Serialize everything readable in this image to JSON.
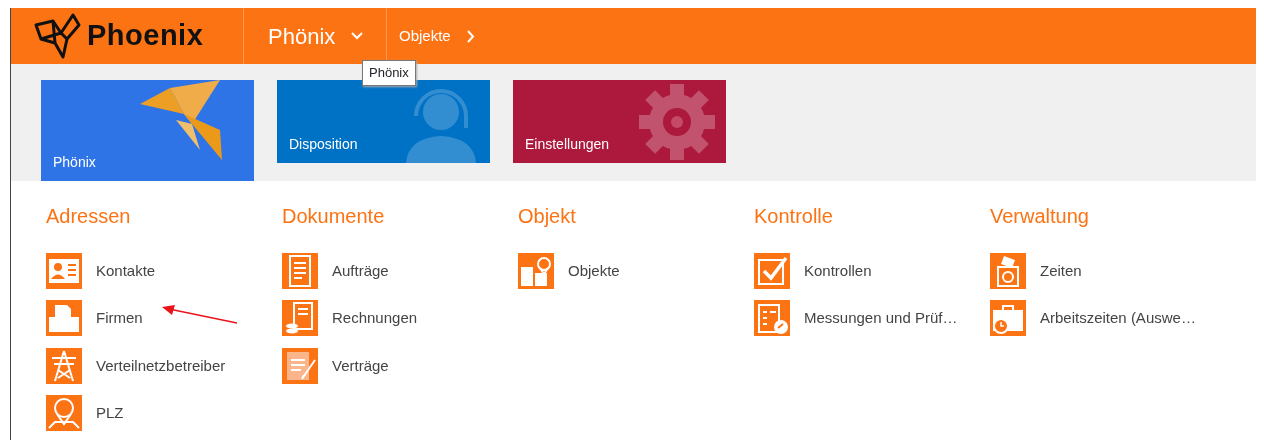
{
  "header": {
    "logo": "Phoenix",
    "breadcrumb": [
      {
        "label": "Phönix",
        "kind": "dropdown"
      },
      {
        "label": "Objekte",
        "kind": "next"
      }
    ],
    "tooltip": "Phönix"
  },
  "tiles": [
    {
      "label": "Phönix",
      "selected": true,
      "color": "#2f74e6"
    },
    {
      "label": "Disposition",
      "selected": false,
      "color": "#0072c6"
    },
    {
      "label": "Einstellungen",
      "selected": false,
      "color": "#ac193d"
    }
  ],
  "sections": [
    {
      "title": "Adressen",
      "items": [
        {
          "label": "Kontakte"
        },
        {
          "label": "Firmen"
        },
        {
          "label": "Verteilnetzbetreiber"
        },
        {
          "label": "PLZ"
        }
      ]
    },
    {
      "title": "Dokumente",
      "items": [
        {
          "label": "Aufträge"
        },
        {
          "label": "Rechnungen"
        },
        {
          "label": "Verträge"
        }
      ]
    },
    {
      "title": "Objekt",
      "items": [
        {
          "label": "Objekte"
        }
      ]
    },
    {
      "title": "Kontrolle",
      "items": [
        {
          "label": "Kontrollen"
        },
        {
          "label": "Messungen und Prüf…"
        }
      ]
    },
    {
      "title": "Verwaltung",
      "items": [
        {
          "label": "Zeiten"
        },
        {
          "label": "Arbeitszeiten (Auswe…"
        }
      ]
    }
  ]
}
